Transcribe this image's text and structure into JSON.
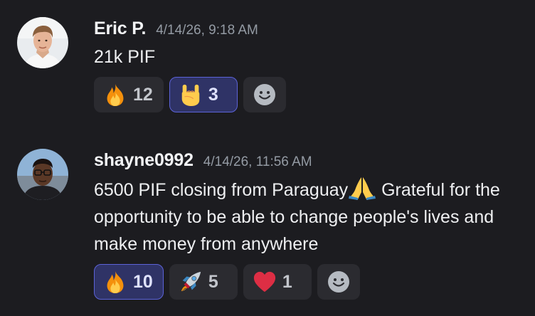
{
  "messages": [
    {
      "author": "Eric P.",
      "timestamp": "4/14/26, 9:18 AM",
      "text": "21k PIF",
      "reactions": [
        {
          "emoji": "fire-icon",
          "count": "12",
          "active": false
        },
        {
          "emoji": "rock-on-hand-icon",
          "count": "3",
          "active": true
        }
      ]
    },
    {
      "author": "shayne0992",
      "timestamp": "4/14/26, 11:56 AM",
      "text_before_emoji": "6500 PIF closing from Paraguay",
      "inline_emoji": "praying-hands-icon",
      "text_after_emoji": " Grateful for the opportunity to be able to change people's lives and make money from anywhere",
      "reactions": [
        {
          "emoji": "fire-icon",
          "count": "10",
          "active": true
        },
        {
          "emoji": "rocket-icon",
          "count": "5",
          "active": false
        },
        {
          "emoji": "heart-icon",
          "count": "1",
          "active": false
        }
      ]
    }
  ],
  "colors": {
    "background": "#1c1c20",
    "reaction_bg": "#2b2b30",
    "reaction_active_bg": "#2f3366",
    "reaction_active_border": "#5c63d8",
    "timestamp": "#949ba4"
  }
}
